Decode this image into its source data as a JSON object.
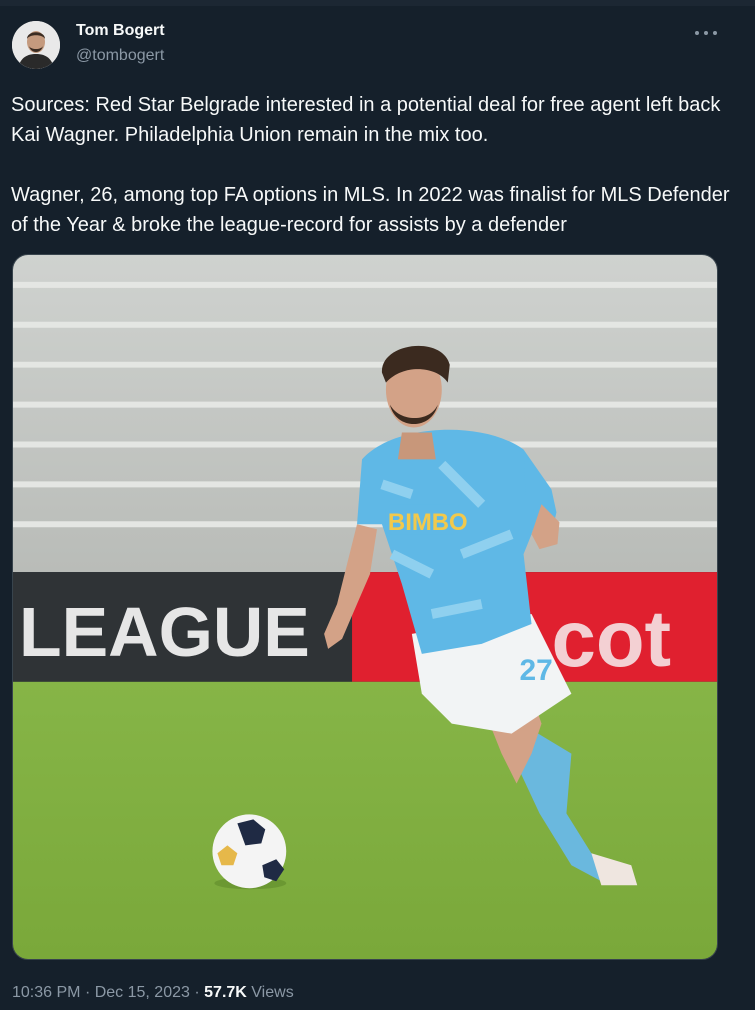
{
  "author": {
    "name": "Tom Bogert",
    "handle": "@tombogert"
  },
  "tweet": {
    "paragraph_1": "Sources: Red Star Belgrade interested in a potential deal for free agent left back Kai Wagner. Philadelphia Union remain in the mix too.",
    "paragraph_2": "Wagner, 26, among top FA options in MLS. In 2022 was finalist for MLS Defender of the Year & broke the league-record for assists by a defender"
  },
  "media": {
    "board_text": "LEAGUE",
    "board_text_right": "cot",
    "shirt_sponsor": "BIMBO",
    "shirt_number": "27",
    "colors": {
      "jersey": "#5fb8e6",
      "grass": "#82b23b",
      "board_red": "#e0202f",
      "stands": "#c9ccc9"
    }
  },
  "meta": {
    "time": "10:36 PM",
    "separator": "·",
    "date": "Dec 15, 2023",
    "views_count": "57.7K",
    "views_label": "Views"
  },
  "icons": {
    "more": "more-options-icon"
  }
}
